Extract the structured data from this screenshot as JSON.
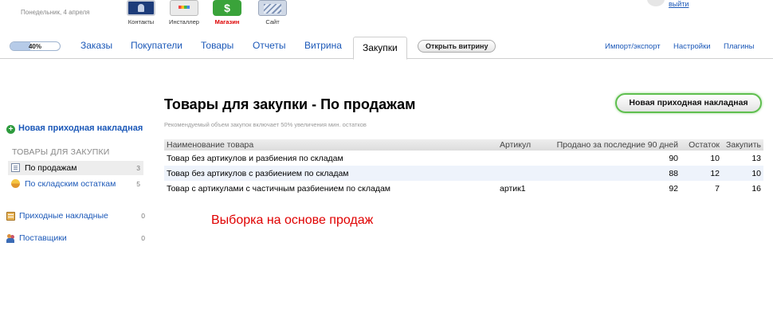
{
  "header": {
    "date": "Понедельник, 4 апреля",
    "apps": [
      {
        "label": "Контакты",
        "icon": "contacts-icon"
      },
      {
        "label": "Инсталлер",
        "icon": "installer-icon"
      },
      {
        "label": "Магазин",
        "icon": "shop-icon"
      },
      {
        "label": "Сайт",
        "icon": "site-icon"
      }
    ],
    "user": {
      "logout_label": "выйти"
    }
  },
  "nav": {
    "progress": {
      "label": "40%",
      "value": 40
    },
    "tabs": [
      {
        "label": "Заказы"
      },
      {
        "label": "Покупатели"
      },
      {
        "label": "Товары"
      },
      {
        "label": "Отчеты"
      },
      {
        "label": "Витрина"
      },
      {
        "label": "Закупки",
        "active": true
      }
    ],
    "open_storefront": "Открыть витрину",
    "right_links": [
      {
        "label": "Импорт/экспорт"
      },
      {
        "label": "Настройки"
      },
      {
        "label": "Плагины"
      }
    ]
  },
  "sidebar": {
    "new_invoice": "Новая приходная накладная",
    "section_heading": "ТОВАРЫ ДЛЯ ЗАКУПКИ",
    "section_items": [
      {
        "label": "По продажам",
        "count": "3",
        "icon": "document-icon",
        "selected": true
      },
      {
        "label": "По складским остаткам",
        "count": "5",
        "icon": "pill-icon",
        "selected": false
      }
    ],
    "links": [
      {
        "label": "Приходные накладные",
        "count": "0",
        "icon": "invoice-icon"
      },
      {
        "label": "Поставщики",
        "count": "0",
        "icon": "suppliers-icon"
      }
    ]
  },
  "main": {
    "title": "Товары для закупки - По продажам",
    "subtitle": "Рекомендуемый объем закупок включает 50% увеличения мин. остатков",
    "new_invoice_button": "Новая приходная накладная",
    "table": {
      "columns": [
        "Наименование товара",
        "Артикул",
        "Продано за последние 90 дней",
        "Остаток",
        "Закупить"
      ],
      "rows": [
        [
          "Товар без артикулов и разбиения по складам",
          "",
          "90",
          "10",
          "13"
        ],
        [
          "Товар без артикулов с разбиением по складам",
          "",
          "88",
          "12",
          "10"
        ],
        [
          "Товар с артикулами с частичным разбиением по складам",
          "артик1",
          "92",
          "7",
          "16"
        ]
      ]
    },
    "annotation": "Выборка на основе продаж"
  }
}
